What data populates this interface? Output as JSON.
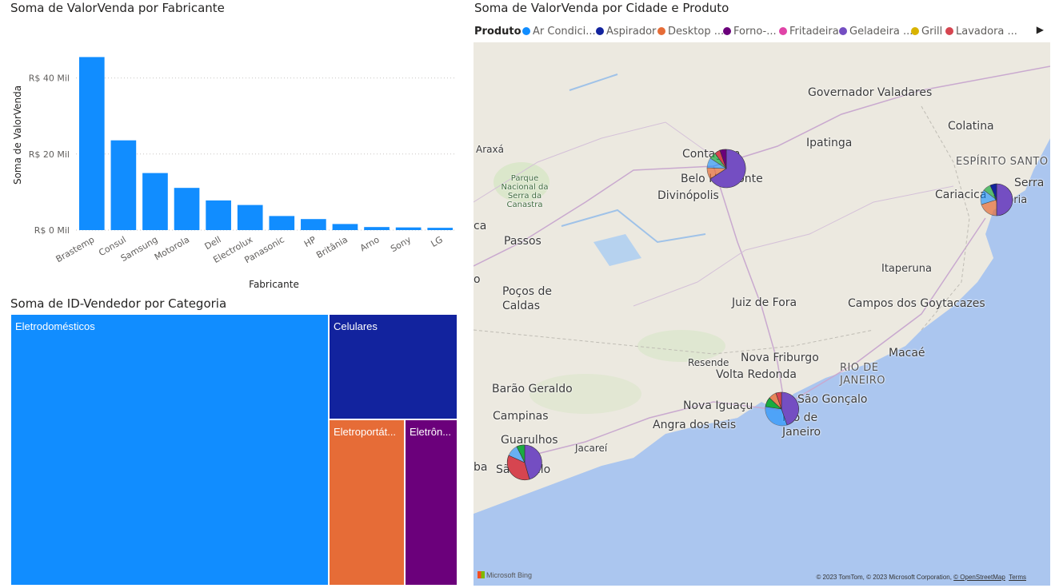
{
  "bar_visual": {
    "title": "Soma de ValorVenda por Fabricante"
  },
  "chart_data": {
    "type": "bar",
    "title": "Soma de ValorVenda por Fabricante",
    "xlabel": "Fabricante",
    "ylabel": "Soma de ValorVenda",
    "categories": [
      "Brastemp",
      "Consul",
      "Samsung",
      "Motorola",
      "Dell",
      "Electrolux",
      "Panasonic",
      "HP",
      "Britânia",
      "Arno",
      "Sony",
      "LG"
    ],
    "values": [
      45.5,
      23.6,
      15.0,
      11.1,
      7.8,
      6.6,
      3.7,
      2.9,
      1.6,
      0.8,
      0.7,
      0.6
    ],
    "yticks": [
      {
        "value": 0,
        "label": "R$ 0 Mil"
      },
      {
        "value": 20,
        "label": "R$ 20 Mil"
      },
      {
        "value": 40,
        "label": "R$ 40 Mil"
      }
    ],
    "ylim": [
      0,
      50
    ],
    "color": "#118DFF",
    "grid": true
  },
  "treemap_visual": {
    "title": "Soma de ID-Vendedor por Categoria",
    "tiles": [
      {
        "label": "Eletrodomésticos",
        "color": "#118DFF"
      },
      {
        "label": "Celulares",
        "color": "#12239E"
      },
      {
        "label": "Eletroportát...",
        "color": "#E66C37"
      },
      {
        "label": "Eletrôn...",
        "color": "#6B007B"
      }
    ]
  },
  "map_visual": {
    "title": "Soma de ValorVenda por Cidade e Produto",
    "legend_title": "Produto",
    "legend_items": [
      {
        "label": "Ar Condici...",
        "color": "#118DFF"
      },
      {
        "label": "Aspirador",
        "color": "#12239E"
      },
      {
        "label": "Desktop ...",
        "color": "#E66C37"
      },
      {
        "label": "Forno-...",
        "color": "#6B007B"
      },
      {
        "label": "Fritadeira",
        "color": "#E044A7"
      },
      {
        "label": "Geladeira ...",
        "color": "#744EC2"
      },
      {
        "label": "Grill",
        "color": "#D9B300"
      },
      {
        "label": "Lavadora ...",
        "color": "#D64550"
      }
    ],
    "legend_arrow": "▶",
    "cities": [
      "Governador Valadares",
      "Colatina",
      "Ipatinga",
      "Araxá",
      "ESPÍRITO SANTO",
      "Serra",
      "Cariacica",
      "Vitória",
      "Contagem",
      "Belo Horizonte",
      "Divinópolis",
      "Parque Nacional da Serra da Canastra",
      "Passos",
      "Itaperuna",
      "Poços de Caldas",
      "Juiz de Fora",
      "Campos dos Goytacazes",
      "Macaé",
      "Nova Friburgo",
      "RIO DE JANEIRO",
      "Resende",
      "Volta Redonda",
      "Barão Geraldo",
      "São Gonçalo",
      "Nova Iguaçu",
      "Rio de Janeiro",
      "Campinas",
      "Angra dos Reis",
      "Guarulhos",
      "Jacareí",
      "São Paulo",
      "ca",
      "o",
      "ba"
    ],
    "bing_label": "Microsoft Bing",
    "attribution": "© 2023 TomTom, © 2023 Microsoft Corporation,",
    "osm_link": "© OpenStreetMap",
    "terms_link": "Terms"
  }
}
